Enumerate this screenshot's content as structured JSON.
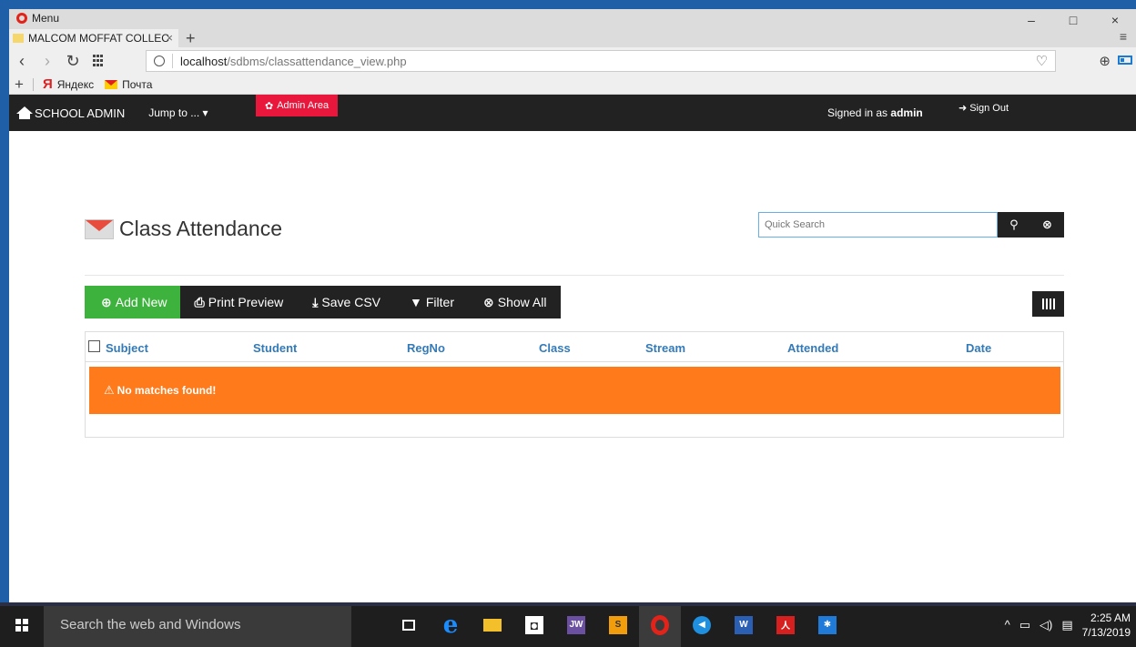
{
  "browser": {
    "menu_label": "Menu",
    "tab_title": "MALCOM MOFFAT COLLEC",
    "tab_close": "×",
    "new_tab": "+",
    "url_host": "localhost",
    "url_path": "/sdbms/classattendance_view.php",
    "window_controls": {
      "minimize": "–",
      "maximize": "□",
      "close": "×"
    }
  },
  "bookmarks": {
    "add": "+",
    "items": [
      {
        "label": "Яндекс",
        "icon": "yandex-icon"
      },
      {
        "label": "Почта",
        "icon": "mail-icon"
      }
    ]
  },
  "navbar": {
    "brand": "SCHOOL ADMIN",
    "jump_to": "Jump to ... ▾",
    "admin_area": "Admin Area",
    "signed_in_prefix": "Signed in as ",
    "signed_in_user": "admin",
    "sign_out": "Sign Out"
  },
  "page": {
    "title": "Class Attendance",
    "search_placeholder": "Quick Search",
    "actions": {
      "add_new": "Add New",
      "print_preview": "Print Preview",
      "save_csv": "Save CSV",
      "filter": "Filter",
      "show_all": "Show All"
    },
    "table": {
      "columns": [
        "Subject",
        "Student",
        "RegNo",
        "Class",
        "Stream",
        "Attended",
        "Date"
      ],
      "empty_message": "No matches found!"
    },
    "colors": {
      "add_new": "#3db33d",
      "alert": "#ff7a1a",
      "admin_area": "#e8173b",
      "header_text": "#337ab7"
    }
  },
  "taskbar": {
    "search_placeholder": "Search the web and Windows",
    "apps": [
      "task-view-icon",
      "edge-icon",
      "file-explorer-icon",
      "store-icon",
      "jw-icon",
      "sublime-icon",
      "opera-icon",
      "media-player-icon",
      "word-icon",
      "acrobat-icon",
      "settings-icon"
    ],
    "jw_label": "JW",
    "time": "2:25 AM",
    "date": "7/13/2019"
  }
}
